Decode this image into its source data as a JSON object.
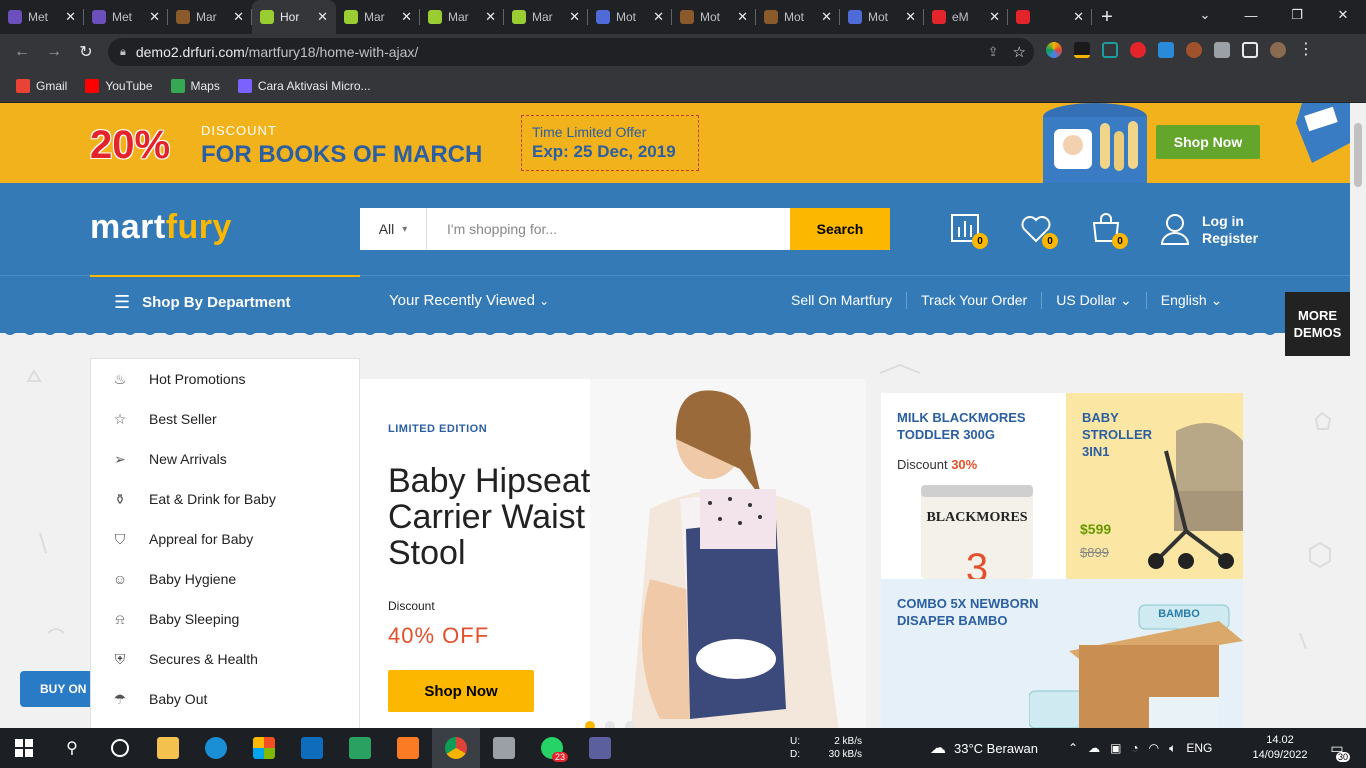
{
  "browser": {
    "tabs": [
      {
        "label": "Met",
        "color": "#6b4fbb"
      },
      {
        "label": "Met",
        "color": "#6b4fbb"
      },
      {
        "label": "Mar",
        "color": "#8a5a2b"
      },
      {
        "label": "Hor",
        "color": "#9acd32",
        "active": true
      },
      {
        "label": "Mar",
        "color": "#9acd32"
      },
      {
        "label": "Mar",
        "color": "#9acd32"
      },
      {
        "label": "Mar",
        "color": "#9acd32"
      },
      {
        "label": "Mot",
        "color": "#4f6bd8"
      },
      {
        "label": "Mot",
        "color": "#8a5a2b"
      },
      {
        "label": "Mot",
        "color": "#8a5a2b"
      },
      {
        "label": "Mot",
        "color": "#4f6bd8"
      },
      {
        "label": "eM",
        "color": "#e3242b"
      },
      {
        "label": "",
        "color": "#e3242b"
      }
    ],
    "url_host": "demo2.drfuri.com",
    "url_path": "/martfury18/home-with-ajax/",
    "bookmarks": [
      {
        "label": "Gmail",
        "color": "#ea4335"
      },
      {
        "label": "YouTube",
        "color": "#ff0000"
      },
      {
        "label": "Maps",
        "color": "#34a853"
      },
      {
        "label": "Cara Aktivasi Micro...",
        "color": "#7b61ff"
      }
    ]
  },
  "promo": {
    "percent": "20%",
    "discount_label": "DISCOUNT",
    "headline": "FOR BOOKS OF MARCH",
    "offer_label": "Time Limited Offer",
    "offer_expiry": "Exp: 25 Dec, 2019",
    "shop_now": "Shop Now"
  },
  "header": {
    "logo_a": "mart",
    "logo_b": "fury",
    "search_category": "All",
    "search_placeholder": "I'm shopping for...",
    "search_button": "Search",
    "compare_count": "0",
    "wishlist_count": "0",
    "cart_count": "0",
    "login": "Log in",
    "register": "Register"
  },
  "nav": {
    "department": "Shop By Department",
    "recent": "Your Recently Viewed",
    "links": [
      "Sell On Martfury",
      "Track Your Order",
      "US Dollar",
      "English"
    ],
    "more_demos": "MORE DEMOS"
  },
  "departments": [
    {
      "label": "Hot Promotions",
      "icon": "fire-icon"
    },
    {
      "label": "Best Seller",
      "icon": "star-icon"
    },
    {
      "label": "New Arrivals",
      "icon": "paper-plane-icon"
    },
    {
      "label": "Eat & Drink for Baby",
      "icon": "bottle-icon"
    },
    {
      "label": "Appreal for Baby",
      "icon": "tshirt-icon"
    },
    {
      "label": "Baby Hygiene",
      "icon": "face-icon"
    },
    {
      "label": "Baby Sleeping",
      "icon": "lamp-icon"
    },
    {
      "label": "Secures & Health",
      "icon": "shield-icon"
    },
    {
      "label": "Baby Out",
      "icon": "umbrella-icon"
    }
  ],
  "hero": {
    "eyebrow": "LIMITED EDITION",
    "title": "Baby Hipseat Carrier Waist Stool",
    "discount_label": "Discount",
    "discount_value": "40% OFF",
    "button": "Shop Now"
  },
  "cards": {
    "milk": {
      "title": "MILK BLACKMORES TODDLER 300G",
      "discount_label": "Discount",
      "discount_value": "30%",
      "brand": "BLACKMORES"
    },
    "stroller": {
      "title": "BABY STROLLER 3IN1",
      "price": "$599",
      "old_price": "$899"
    },
    "diaper": {
      "title": "COMBO 5X NEWBORN DISAPER BAMBO",
      "brand": "BAMBO"
    }
  },
  "buy_on": "BUY ON",
  "taskbar": {
    "net_up_label": "U:",
    "net_up": "2 kB/s",
    "net_down_label": "D:",
    "net_down": "30 kB/s",
    "weather": "33°C  Berawan",
    "lang": "ENG",
    "time": "14.02",
    "date": "14/09/2022",
    "whatsapp_badge": "23",
    "notif_count": "30"
  }
}
